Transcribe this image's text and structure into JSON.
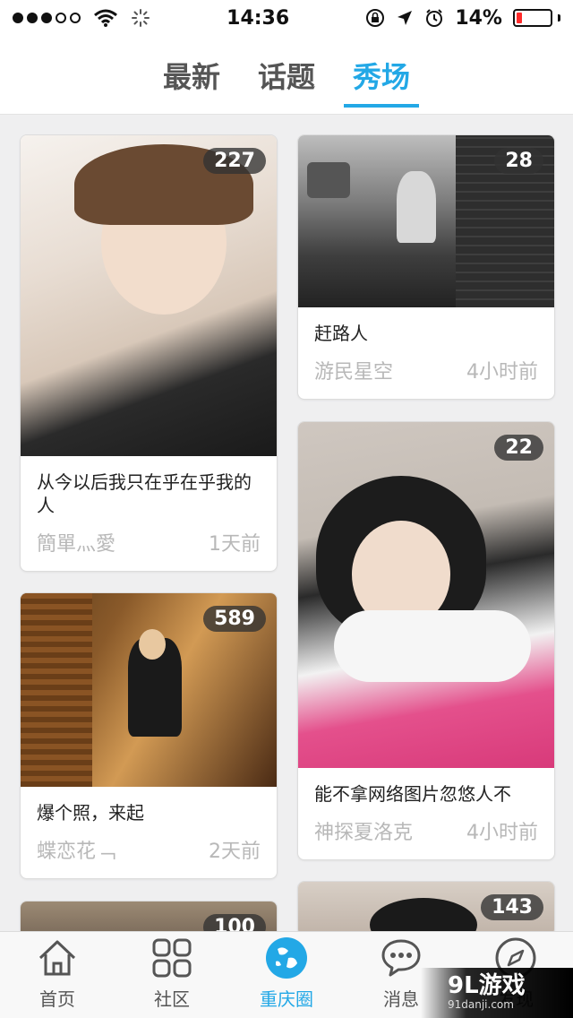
{
  "status_bar": {
    "time": "14:36",
    "battery_percent": "14%",
    "signal_filled": 3,
    "signal_total": 5
  },
  "tabs": [
    {
      "label": "最新",
      "active": false
    },
    {
      "label": "话题",
      "active": false
    },
    {
      "label": "秀场",
      "active": true
    }
  ],
  "cards": [
    {
      "count": "227",
      "title": "从今以后我只在乎在乎我的人",
      "author": "簡單灬愛",
      "time": "1天前"
    },
    {
      "count": "28",
      "title": "赶路人",
      "author": "游民星空",
      "time": "4小时前"
    },
    {
      "count": "589",
      "title": "爆个照，来起",
      "author": "蝶恋花﹁",
      "time": "2天前"
    },
    {
      "count": "22",
      "title": "能不拿网络图片忽悠人不",
      "author": "神探夏洛克",
      "time": "4小时前"
    },
    {
      "count": "100"
    },
    {
      "count": "143"
    }
  ],
  "bottom_nav": [
    {
      "label": "首页",
      "icon": "home-icon"
    },
    {
      "label": "社区",
      "icon": "grid-icon"
    },
    {
      "label": "重庆圈",
      "icon": "globe-icon",
      "active": true
    },
    {
      "label": "消息",
      "icon": "chat-bubble-icon"
    },
    {
      "label": "发现",
      "icon": "compass-icon"
    }
  ],
  "watermark": {
    "logo": "9L游戏",
    "url": "91danji.com"
  },
  "colors": {
    "accent": "#23a8e6",
    "battery_low": "#ff2a2a"
  }
}
